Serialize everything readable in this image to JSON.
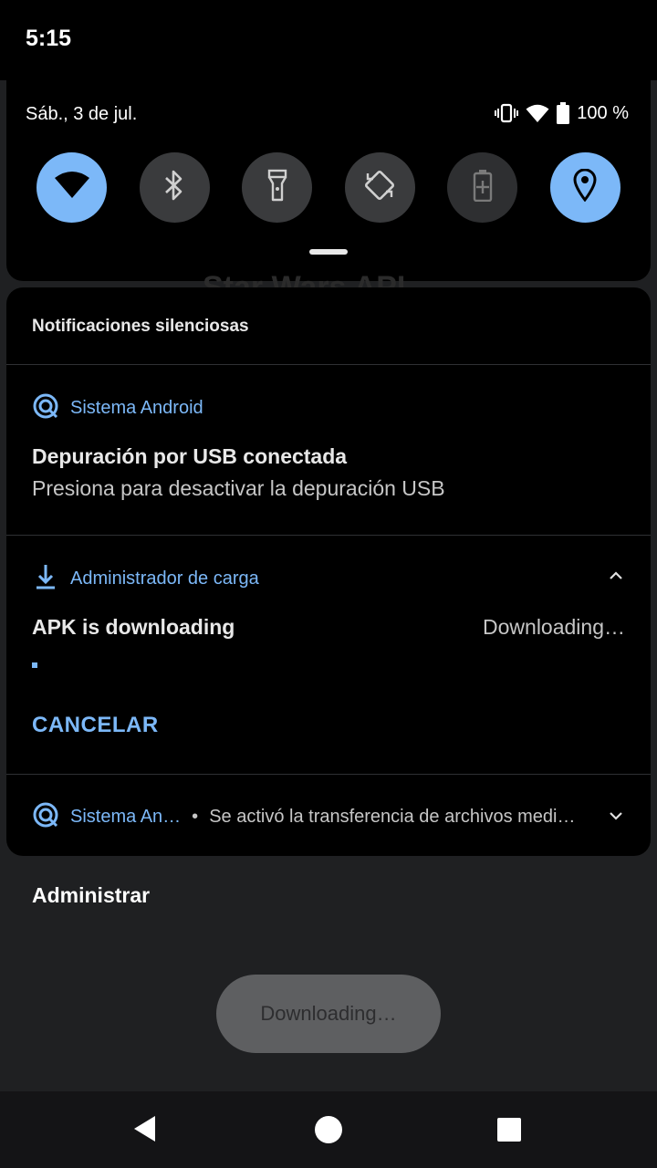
{
  "status_bar": {
    "time": "5:15"
  },
  "quick_settings": {
    "date": "Sáb., 3 de jul.",
    "battery_percent": "100 %",
    "tiles": [
      {
        "icon": "wifi-icon",
        "state": "on"
      },
      {
        "icon": "bluetooth-icon",
        "state": "off"
      },
      {
        "icon": "flashlight-icon",
        "state": "off"
      },
      {
        "icon": "auto-rotate-icon",
        "state": "off"
      },
      {
        "icon": "battery-saver-icon",
        "state": "unavailable"
      },
      {
        "icon": "location-icon",
        "state": "on"
      }
    ]
  },
  "background_text": "Star Wars API",
  "notifications": {
    "section_title": "Notificaciones silenciosas",
    "items": [
      {
        "app": "Sistema Android",
        "title": "Depuración por USB conectada",
        "text": "Presiona para desactivar la depuración USB"
      },
      {
        "app": "Administrador de carga",
        "title": "APK is downloading",
        "status": "Downloading…",
        "action": "CANCELAR"
      },
      {
        "app": "Sistema An…",
        "separator": "•",
        "text": "Se activó la transferencia de archivos medi…"
      }
    ]
  },
  "manage_label": "Administrar",
  "toast": "Downloading…",
  "colors": {
    "accent": "#7cb8f8",
    "panel": "#000000",
    "background": "#1f2022"
  }
}
